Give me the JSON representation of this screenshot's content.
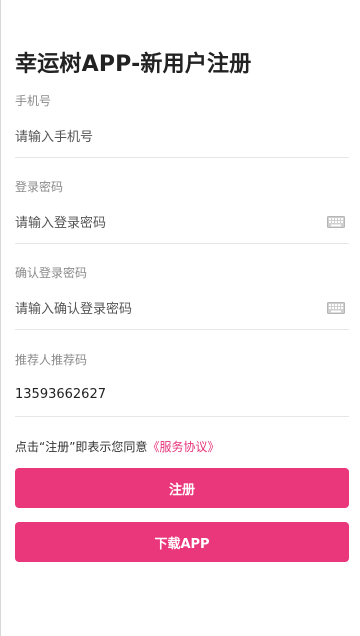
{
  "page": {
    "title": "幸运树APP-新用户注册"
  },
  "form": {
    "phone": {
      "label": "手机号",
      "placeholder": "请输入手机号"
    },
    "password": {
      "label": "登录密码",
      "placeholder": "请输入登录密码",
      "icon": "keyboard-icon"
    },
    "confirm_password": {
      "label": "确认登录密码",
      "placeholder": "请输入确认登录密码",
      "icon": "keyboard-icon"
    },
    "referrer": {
      "label": "推荐人推荐码",
      "value": "13593662627"
    }
  },
  "agreement": {
    "prefix": "点击“注册”即表示您同意",
    "link": "《服务协议》"
  },
  "buttons": {
    "register": "注册",
    "download": "下载APP"
  },
  "colors": {
    "accent": "#ea367a",
    "link": "#e5337a"
  }
}
